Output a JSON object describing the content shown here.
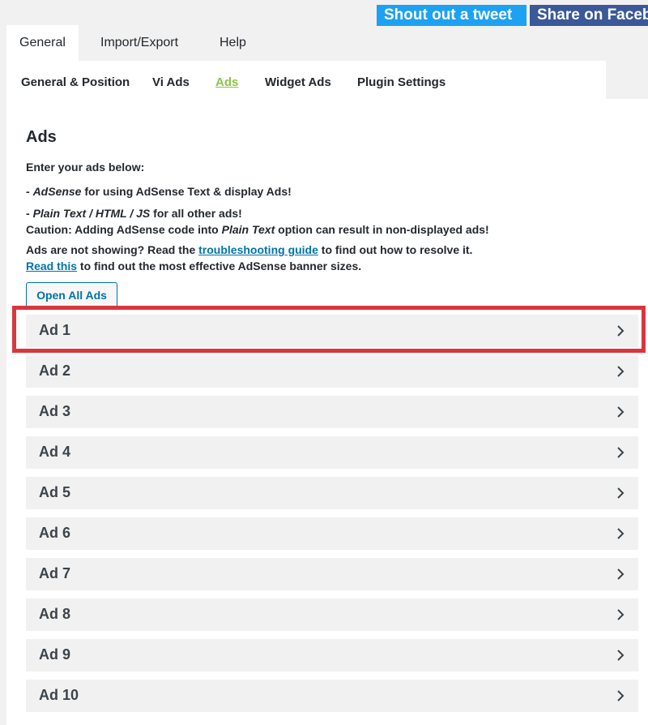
{
  "share": {
    "tweet_label": "Shout out a tweet",
    "facebook_label": "Share on Facebook"
  },
  "main_tabs": [
    {
      "label": "General",
      "active": true
    },
    {
      "label": "Import/Export",
      "active": false
    },
    {
      "label": "Help",
      "active": false
    }
  ],
  "sub_tabs": [
    {
      "label": "General & Position",
      "active": false
    },
    {
      "label": "Vi Ads",
      "active": false
    },
    {
      "label": "Ads",
      "active": true
    },
    {
      "label": "Widget Ads",
      "active": false
    },
    {
      "label": "Plugin Settings",
      "active": false
    }
  ],
  "section": {
    "title": "Ads",
    "intro": "Enter your ads below:",
    "adsense_prefix": "- ",
    "adsense_em": "AdSense",
    "adsense_rest": " for using AdSense Text & display Ads!",
    "plain_prefix": "- ",
    "plain_em": "Plain Text / HTML / JS",
    "plain_rest": " for all other ads!",
    "caution_prefix": "Caution: Adding AdSense code into ",
    "caution_em": "Plain Text",
    "caution_rest": " option can result in non-displayed ads!",
    "trouble_prefix": "Ads are not showing? Read the ",
    "trouble_link": "troubleshooting guide",
    "trouble_rest": " to find out how to resolve it.",
    "read_link": "Read this",
    "read_rest": " to find out the most effective AdSense banner sizes."
  },
  "open_all_label": "Open All Ads",
  "ads": [
    "Ad 1",
    "Ad 2",
    "Ad 3",
    "Ad 4",
    "Ad 5",
    "Ad 6",
    "Ad 7",
    "Ad 8",
    "Ad 9",
    "Ad 10"
  ],
  "icons": {
    "chevron": "chevron-right-icon"
  },
  "colors": {
    "tweet": "#1da1f2",
    "facebook": "#3b5998",
    "active_subtab": "#8bc34a",
    "link": "#0073aa",
    "highlight": "#d9363e"
  }
}
